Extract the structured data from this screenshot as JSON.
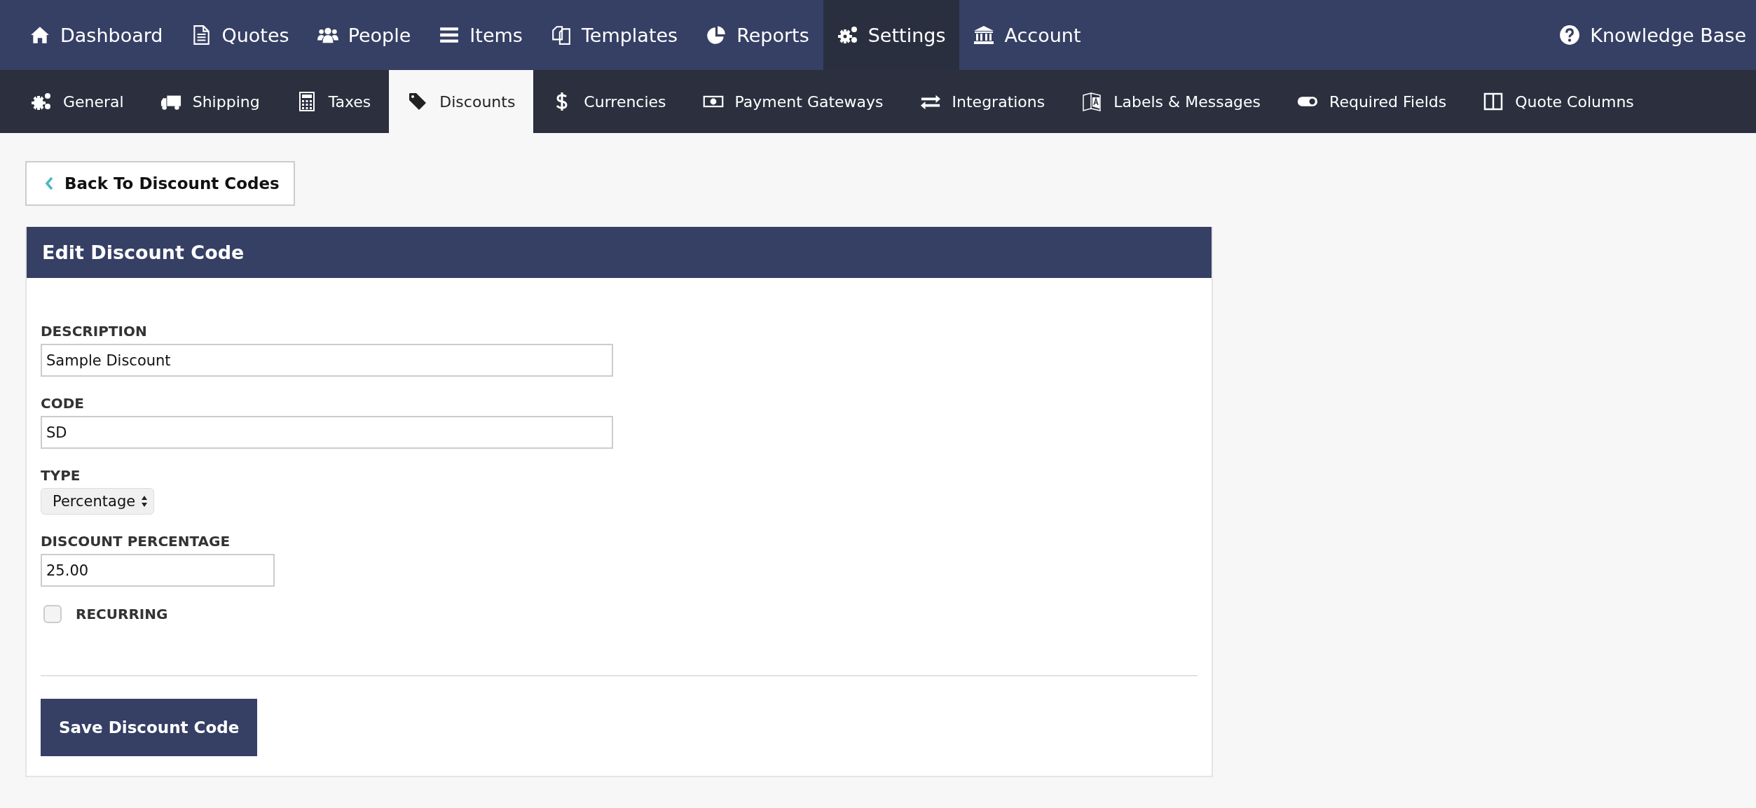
{
  "top_nav": {
    "items": [
      {
        "label": "Dashboard",
        "selected": false
      },
      {
        "label": "Quotes",
        "selected": false
      },
      {
        "label": "People",
        "selected": false
      },
      {
        "label": "Items",
        "selected": false
      },
      {
        "label": "Templates",
        "selected": false
      },
      {
        "label": "Reports",
        "selected": false
      },
      {
        "label": "Settings",
        "selected": true
      },
      {
        "label": "Account",
        "selected": false
      }
    ],
    "help_link": "Knowledge Base"
  },
  "sub_nav": {
    "items": [
      {
        "label": "General",
        "selected": false
      },
      {
        "label": "Shipping",
        "selected": false
      },
      {
        "label": "Taxes",
        "selected": false
      },
      {
        "label": "Discounts",
        "selected": true
      },
      {
        "label": "Currencies",
        "selected": false
      },
      {
        "label": "Payment Gateways",
        "selected": false
      },
      {
        "label": "Integrations",
        "selected": false
      },
      {
        "label": "Labels & Messages",
        "selected": false
      },
      {
        "label": "Required Fields",
        "selected": false
      },
      {
        "label": "Quote Columns",
        "selected": false
      }
    ]
  },
  "back_button": "Back To Discount Codes",
  "panel": {
    "title": "Edit Discount Code",
    "fields": [
      {
        "kind": "text",
        "label": "DESCRIPTION",
        "value": "Sample Discount"
      },
      {
        "kind": "text",
        "label": "CODE",
        "value": "SD"
      },
      {
        "kind": "select",
        "label": "TYPE",
        "value": "Percentage"
      },
      {
        "kind": "short",
        "label": "DISCOUNT PERCENTAGE",
        "value": "25.00"
      },
      {
        "kind": "checkbox",
        "label": "RECURRING",
        "checked": false
      }
    ],
    "save_button": "Save Discount Code"
  }
}
